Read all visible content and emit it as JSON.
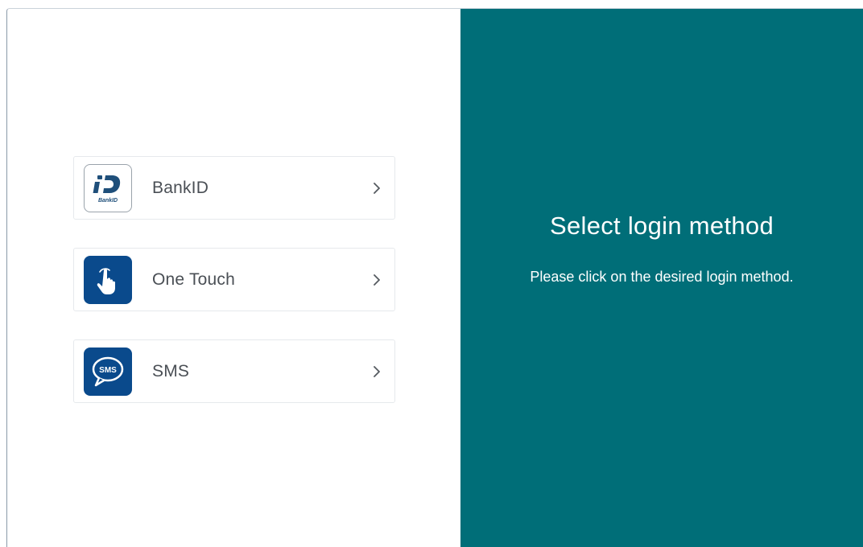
{
  "colors": {
    "accent": "#006e78",
    "icon_blue": "#0a4a8c"
  },
  "methods": [
    {
      "label": "BankID",
      "icon": "bankid-icon",
      "icon_text": "BankID"
    },
    {
      "label": "One Touch",
      "icon": "touch-hand-icon"
    },
    {
      "label": "SMS",
      "icon": "sms-bubble-icon",
      "icon_text": "SMS"
    }
  ],
  "info": {
    "title": "Select login method",
    "subtitle": "Please click on the desired login method."
  }
}
